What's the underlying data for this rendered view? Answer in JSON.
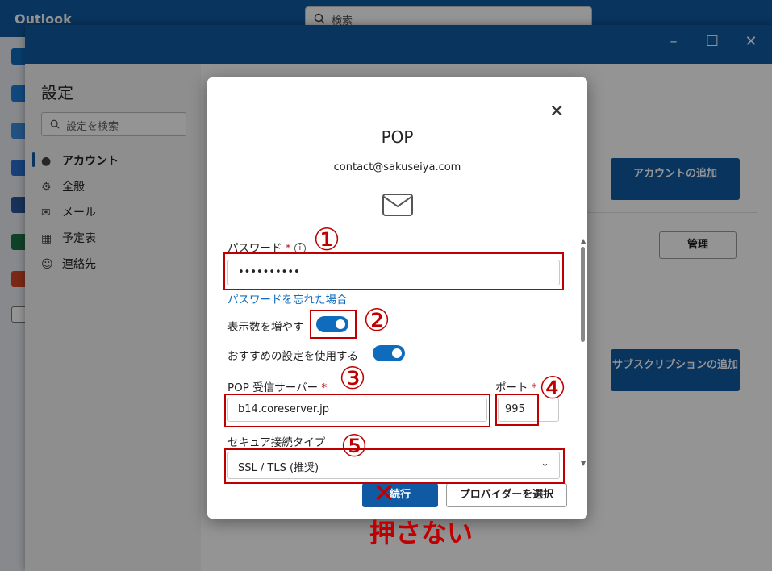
{
  "app": {
    "title": "Outlook"
  },
  "search": {
    "placeholder": "検索"
  },
  "settings": {
    "title": "設定",
    "search_placeholder": "設定を検索",
    "nav": [
      {
        "label": "アカウント",
        "icon": "person-icon"
      },
      {
        "label": "全般",
        "icon": "gear-icon"
      },
      {
        "label": "メール",
        "icon": "mail-icon"
      },
      {
        "label": "予定表",
        "icon": "calendar-icon"
      },
      {
        "label": "連絡先",
        "icon": "people-icon"
      }
    ],
    "add_account": "アカウントの追加",
    "manage": "管理",
    "add_subscription": "サブスクリプションの追加"
  },
  "dialog": {
    "title": "POP",
    "email": "contact@sakuseiya.com",
    "password_label": "パスワード",
    "password_value": "••••••••••",
    "forgot_password": "パスワードを忘れた場合",
    "show_more_label": "表示数を増やす",
    "recommended_label": "おすすめの設定を使用する",
    "pop_server_label": "POP 受信サーバー",
    "pop_server_value": "b14.coreserver.jp",
    "port_label": "ポート",
    "port_value": "995",
    "secure_label": "セキュア接続タイプ",
    "secure_value": "SSL / TLS (推奨)",
    "continue_button": "続行",
    "provider_button": "プロバイダーを選択"
  },
  "annotations": {
    "n1": "①",
    "n2": "②",
    "n3": "③",
    "n4": "④",
    "n5": "⑤",
    "cross": "✕",
    "do_not_press": "押さない"
  },
  "colors": {
    "brand": "#0f5aa3",
    "accent": "#0f6cbd",
    "annotation": "#c00000"
  }
}
